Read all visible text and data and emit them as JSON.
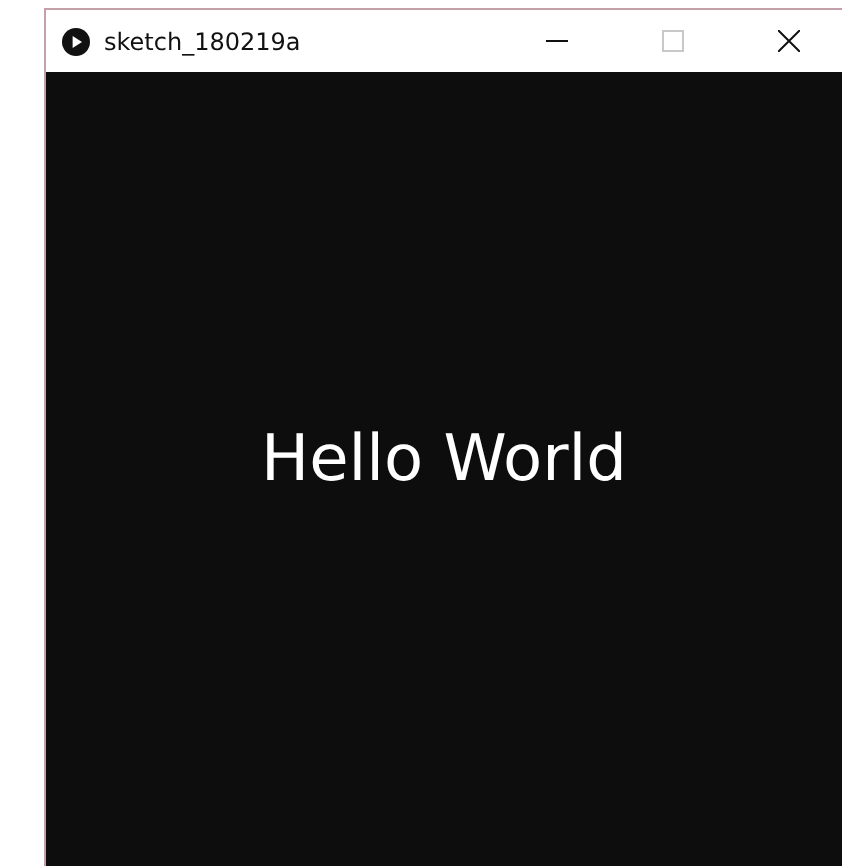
{
  "window": {
    "title": "sketch_180219a",
    "controls": [
      {
        "kind": "minimize",
        "disabled": false
      },
      {
        "kind": "maximize",
        "disabled": true
      },
      {
        "kind": "close",
        "disabled": false
      }
    ]
  },
  "canvas": {
    "text": "Hello World"
  }
}
